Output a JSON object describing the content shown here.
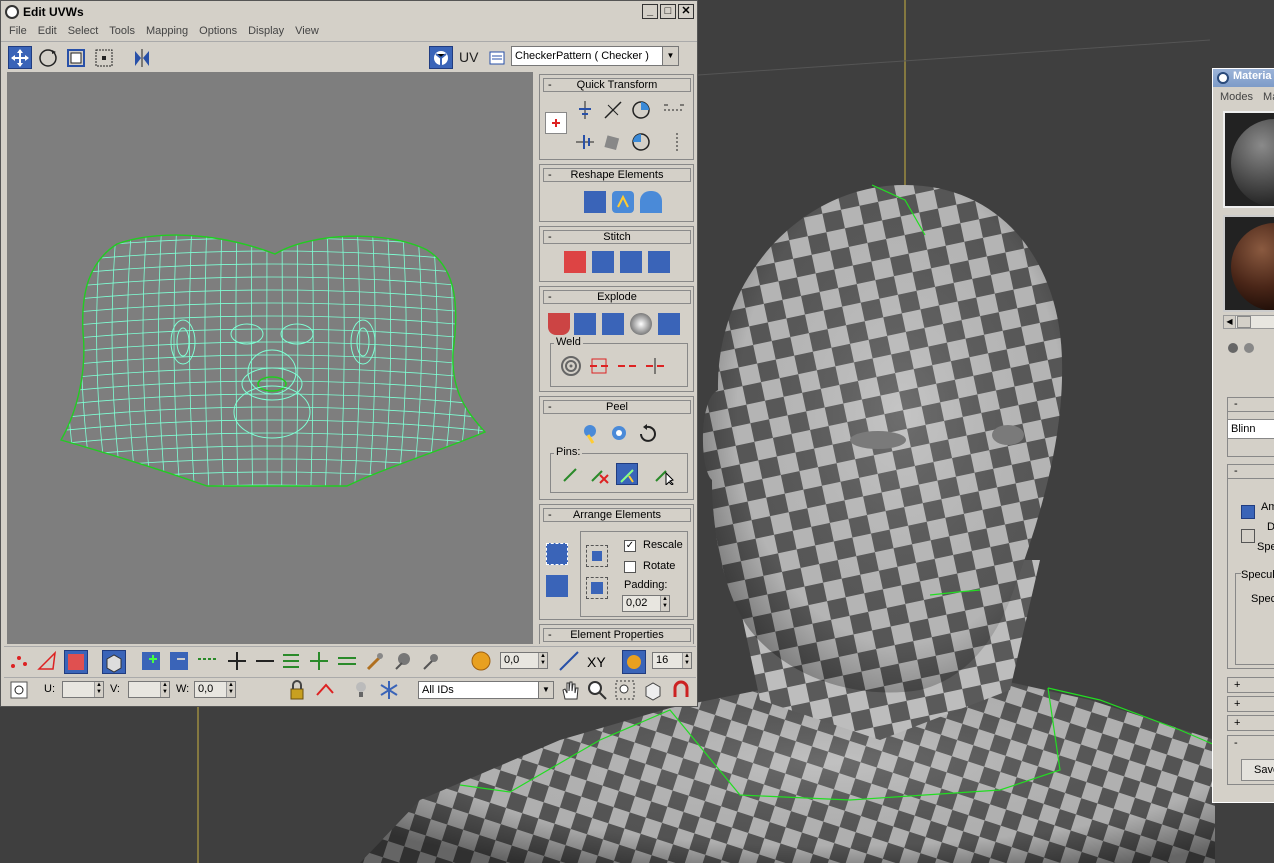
{
  "uvw_window": {
    "title": "Edit UVWs",
    "window_buttons": [
      "_",
      "□",
      "✕"
    ],
    "menu": [
      "File",
      "Edit",
      "Select",
      "Tools",
      "Mapping",
      "Options",
      "Display",
      "View"
    ],
    "toolbar": {
      "uv_label": "UV",
      "texture_dropdown": "CheckerPattern  ( Checker )"
    },
    "rollouts": {
      "quick_transform": "Quick Transform",
      "reshape_elements": "Reshape Elements",
      "stitch": "Stitch",
      "explode": "Explode",
      "weld": "Weld",
      "peel": "Peel",
      "pins": "Pins:",
      "arrange_elements": "Arrange Elements",
      "rescale": "Rescale",
      "rescale_checked": true,
      "rotate": "Rotate",
      "rotate_checked": false,
      "padding_label": "Padding:",
      "padding_value": "0,02",
      "element_properties": "Element Properties",
      "collapse_symbol": "-"
    },
    "bottom_bar": {
      "soft_value": "0,0",
      "xy_label": "XY",
      "brush_value": "16",
      "u_label": "U:",
      "v_label": "V:",
      "w_label": "W:",
      "w_value": "0,0",
      "ids_dropdown": "All IDs"
    }
  },
  "material_editor": {
    "title": "Materia",
    "menu": [
      "Modes",
      "Ma"
    ],
    "shader": "Blinn",
    "labels": [
      "Am",
      "D",
      "Spe",
      "Specul",
      "Spec"
    ],
    "save_label": "Save",
    "rollout_symbols": [
      "-",
      "-",
      "+",
      "+",
      "+",
      "-"
    ]
  },
  "colors": {
    "viewport_bg": "#3f3f3f",
    "uv_bg": "#7e7e7e",
    "uv_mesh": "#7fffd4",
    "uv_border": "#22cc22",
    "checker_light": "#bdbdbd",
    "checker_dark": "#5a5a5a",
    "active_blue": "#3a64b8"
  }
}
